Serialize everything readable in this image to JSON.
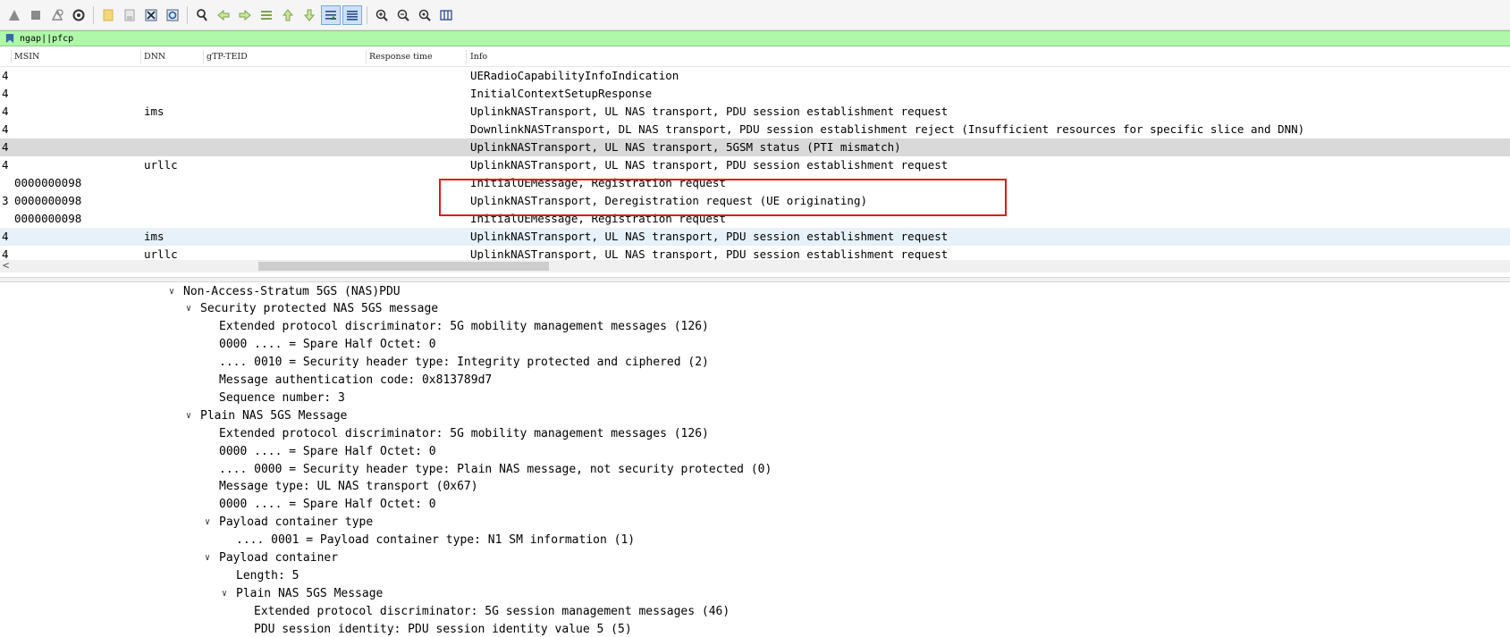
{
  "toolbar": {
    "buttons": [
      {
        "id": "start-capture",
        "icon": "shark-fin-icon"
      },
      {
        "id": "stop-capture",
        "icon": "stop-icon"
      },
      {
        "id": "restart-capture",
        "icon": "restart-icon"
      },
      {
        "id": "capture-options",
        "icon": "gear-icon"
      },
      {
        "id": "open-file",
        "icon": "folder-icon"
      },
      {
        "id": "save-file",
        "icon": "save-icon"
      },
      {
        "id": "close-file",
        "icon": "close-file-icon"
      },
      {
        "id": "reload-file",
        "icon": "reload-icon"
      },
      {
        "id": "find-packet",
        "icon": "search-icon"
      },
      {
        "id": "go-back",
        "icon": "arrow-left-icon"
      },
      {
        "id": "go-forward",
        "icon": "arrow-right-icon"
      },
      {
        "id": "go-to-packet",
        "icon": "goto-icon"
      },
      {
        "id": "go-first",
        "icon": "arrow-up-icon"
      },
      {
        "id": "go-last",
        "icon": "arrow-down-icon"
      },
      {
        "id": "autoscroll",
        "icon": "autoscroll-icon"
      },
      {
        "id": "colorize",
        "icon": "colorize-icon"
      },
      {
        "id": "zoom-in",
        "icon": "zoom-in-icon"
      },
      {
        "id": "zoom-out",
        "icon": "zoom-out-icon"
      },
      {
        "id": "zoom-normal",
        "icon": "zoom-normal-icon"
      },
      {
        "id": "resize-columns",
        "icon": "resize-columns-icon"
      }
    ]
  },
  "filter": {
    "value": "ngap||pfcp"
  },
  "packet_list": {
    "columns": [
      "MSIN",
      "DNN",
      "gTP-TEID",
      "Response time",
      "Info"
    ],
    "rows": [
      {
        "c0": "4",
        "msin": "",
        "dnn": "",
        "info": "UERadioCapabilityInfoIndication",
        "state": ""
      },
      {
        "c0": "4",
        "msin": "",
        "dnn": "",
        "info": "InitialContextSetupResponse",
        "state": ""
      },
      {
        "c0": "4",
        "msin": "",
        "dnn": "ims",
        "info": "UplinkNASTransport, UL NAS transport, PDU session establishment request",
        "state": ""
      },
      {
        "c0": "4",
        "msin": "",
        "dnn": "",
        "info": "DownlinkNASTransport, DL NAS transport, PDU session establishment reject (Insufficient resources for specific slice and DNN)",
        "state": ""
      },
      {
        "c0": "4",
        "msin": "",
        "dnn": "",
        "info": "UplinkNASTransport, UL NAS transport, 5GSM status (PTI mismatch)",
        "state": "selected"
      },
      {
        "c0": "4",
        "msin": "",
        "dnn": "urllc",
        "info": "UplinkNASTransport, UL NAS transport, PDU session establishment request",
        "state": ""
      },
      {
        "c0": "",
        "msin": "0000000098",
        "dnn": "",
        "info": "InitialUEMessage, Registration request",
        "state": ""
      },
      {
        "c0": "3",
        "msin": "0000000098",
        "dnn": "",
        "info": "UplinkNASTransport, Deregistration request (UE originating)",
        "state": ""
      },
      {
        "c0": "",
        "msin": "0000000098",
        "dnn": "",
        "info": "InitialUEMessage, Registration request",
        "state": ""
      },
      {
        "c0": "4",
        "msin": "",
        "dnn": "ims",
        "info": "UplinkNASTransport, UL NAS transport, PDU session establishment request",
        "state": "highlight"
      },
      {
        "c0": "4",
        "msin": "",
        "dnn": "urllc",
        "info": "UplinkNASTransport, UL NAS transport, PDU session establishment request",
        "state": ""
      }
    ],
    "scroll_left_arrow": "<"
  },
  "details": {
    "lines": [
      {
        "text": "Non-Access-Stratum 5GS (NAS)PDU",
        "level": 0,
        "expander": "open"
      },
      {
        "text": "Security protected NAS 5GS message",
        "level": 1,
        "expander": "open"
      },
      {
        "text": "Extended protocol discriminator: 5G mobility management messages (126)",
        "level": 2,
        "expander": ""
      },
      {
        "text": "0000 .... = Spare Half Octet: 0",
        "level": 2,
        "expander": ""
      },
      {
        "text": ".... 0010 = Security header type: Integrity protected and ciphered (2)",
        "level": 2,
        "expander": ""
      },
      {
        "text": "Message authentication code: 0x813789d7",
        "level": 2,
        "expander": ""
      },
      {
        "text": "Sequence number: 3",
        "level": 2,
        "expander": ""
      },
      {
        "text": "Plain NAS 5GS Message",
        "level": 1,
        "expander": "open"
      },
      {
        "text": "Extended protocol discriminator: 5G mobility management messages (126)",
        "level": 2,
        "expander": ""
      },
      {
        "text": "0000 .... = Spare Half Octet: 0",
        "level": 2,
        "expander": ""
      },
      {
        "text": ".... 0000 = Security header type: Plain NAS message, not security protected (0)",
        "level": 2,
        "expander": ""
      },
      {
        "text": "Message type: UL NAS transport (0x67)",
        "level": 2,
        "expander": ""
      },
      {
        "text": "0000 .... = Spare Half Octet: 0",
        "level": 2,
        "expander": ""
      },
      {
        "text": "Payload container type",
        "level": 2,
        "expander": "open"
      },
      {
        "text": ".... 0001 = Payload container type: N1 SM information (1)",
        "level": 3,
        "expander": ""
      },
      {
        "text": "Payload container",
        "level": 2,
        "expander": "open"
      },
      {
        "text": "Length: 5",
        "level": 3,
        "expander": ""
      },
      {
        "text": "Plain NAS 5GS Message",
        "level": 3,
        "expander": "open"
      },
      {
        "text": "Extended protocol discriminator: 5G session management messages (46)",
        "level": 4,
        "expander": ""
      },
      {
        "text": "PDU session identity: PDU session identity value 5 (5)",
        "level": 4,
        "expander": ""
      }
    ]
  },
  "colors": {
    "filter_bg": "#aff8a9",
    "selected_row": "#d9d9d9",
    "highlight_row": "#e6f1fa",
    "annotation_box": "#e0191b"
  }
}
